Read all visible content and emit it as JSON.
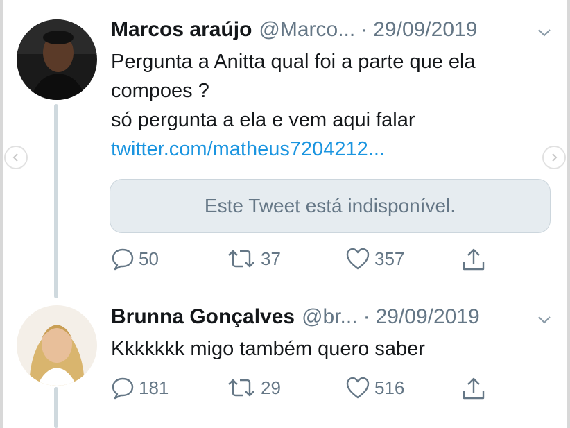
{
  "tweets": [
    {
      "name": "Marcos araújo",
      "handle": "@Marco...",
      "separator": "·",
      "date": "29/09/2019",
      "text_lines": [
        "Pergunta a Anitta qual foi a parte que ela",
        "compoes ?",
        "só pergunta a ela e vem aqui falar"
      ],
      "link": "twitter.com/matheus7204212...",
      "quoted_unavailable": "Este Tweet está indisponível.",
      "replies": "50",
      "retweets": "37",
      "likes": "357"
    },
    {
      "name": "Brunna Gonçalves",
      "handle": "@br...",
      "separator": "·",
      "date": "29/09/2019",
      "text_lines": [
        "Kkkkkkk migo também quero saber"
      ],
      "replies": "181",
      "retweets": "29",
      "likes": "516"
    }
  ],
  "icons": {
    "reply": "reply-icon",
    "retweet": "retweet-icon",
    "like": "like-icon",
    "share": "share-icon",
    "caret": "chevron-down-icon",
    "carousel_prev": "chevron-left-icon",
    "carousel_next": "chevron-right-icon"
  },
  "colors": {
    "link": "#1b95e0",
    "secondary_text": "#657786",
    "thread_line": "#cfd9de"
  }
}
